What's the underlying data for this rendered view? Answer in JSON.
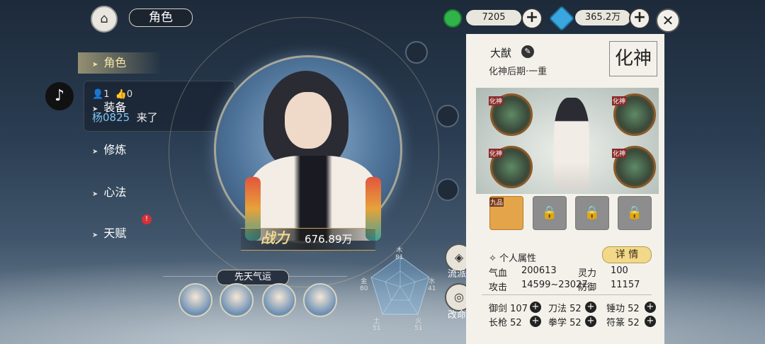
{
  "header": {
    "title": "角色",
    "currency1": "7205",
    "currency2": "365.2万"
  },
  "menu": {
    "items": [
      "角色",
      "装备",
      "修炼",
      "心法",
      "天赋"
    ]
  },
  "live": {
    "viewers": "1",
    "likes": "0",
    "user": "杨0825",
    "action": "来了"
  },
  "portrait": {
    "power_label": "战力",
    "power_value": "676.89万"
  },
  "luck": {
    "title": "先天气运"
  },
  "radar": {
    "labels": [
      "木",
      "水",
      "火",
      "土",
      "金"
    ],
    "values": [
      "81",
      "41",
      "51",
      "51",
      "80"
    ]
  },
  "side_buttons": {
    "school": "流派",
    "fate": "改命"
  },
  "panel": {
    "name": "大猷",
    "realm": "化神后期·一重",
    "realm_badge": "化神",
    "gear_tag": "化神",
    "main_slot_tag": "九品",
    "section": "个人属性",
    "detail": "详 情",
    "attrs": {
      "hp_label": "气血",
      "hp": "200613",
      "sp_label": "灵力",
      "sp": "100",
      "atk_label": "攻击",
      "atk": "14599~23027",
      "def_label": "防御",
      "def": "11157"
    },
    "skills": [
      {
        "name": "御剑",
        "lv": "107"
      },
      {
        "name": "刀法",
        "lv": "52"
      },
      {
        "name": "锤功",
        "lv": "52"
      },
      {
        "name": "长枪",
        "lv": "52"
      },
      {
        "name": "拳学",
        "lv": "52"
      },
      {
        "name": "符篆",
        "lv": "52"
      }
    ]
  }
}
